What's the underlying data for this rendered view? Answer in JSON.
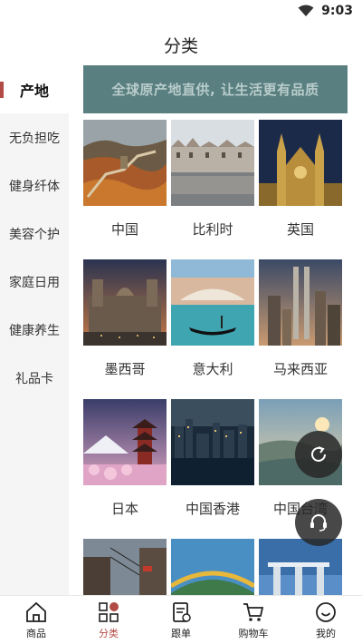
{
  "status": {
    "time": "9:03"
  },
  "header": {
    "title": "分类"
  },
  "sidebar": {
    "items": [
      {
        "label": "产地",
        "active": true
      },
      {
        "label": "无负担吃",
        "active": false
      },
      {
        "label": "健身纤体",
        "active": false
      },
      {
        "label": "美容个护",
        "active": false
      },
      {
        "label": "家庭日用",
        "active": false
      },
      {
        "label": "健康养生",
        "active": false
      },
      {
        "label": "礼品卡",
        "active": false
      }
    ]
  },
  "banner": {
    "text": "全球原产地直供, 让生活更有品质"
  },
  "grid": {
    "items": [
      {
        "label": "中国"
      },
      {
        "label": "比利时"
      },
      {
        "label": "英国"
      },
      {
        "label": "墨西哥"
      },
      {
        "label": "意大利"
      },
      {
        "label": "马来西亚"
      },
      {
        "label": "日本"
      },
      {
        "label": "中国香港"
      },
      {
        "label": "中国台湾"
      },
      {
        "label": ""
      },
      {
        "label": ""
      },
      {
        "label": ""
      }
    ]
  },
  "bottom_nav": {
    "items": [
      {
        "label": "商品",
        "icon": "home-icon"
      },
      {
        "label": "分类",
        "icon": "category-icon",
        "active": true
      },
      {
        "label": "跟单",
        "icon": "order-icon"
      },
      {
        "label": "购物车",
        "icon": "cart-icon"
      },
      {
        "label": "我的",
        "icon": "profile-icon"
      }
    ]
  },
  "colors": {
    "accent": "#b24a45",
    "banner_bg": "#5a7f80",
    "sidebar_bg": "#f5f5f5"
  }
}
